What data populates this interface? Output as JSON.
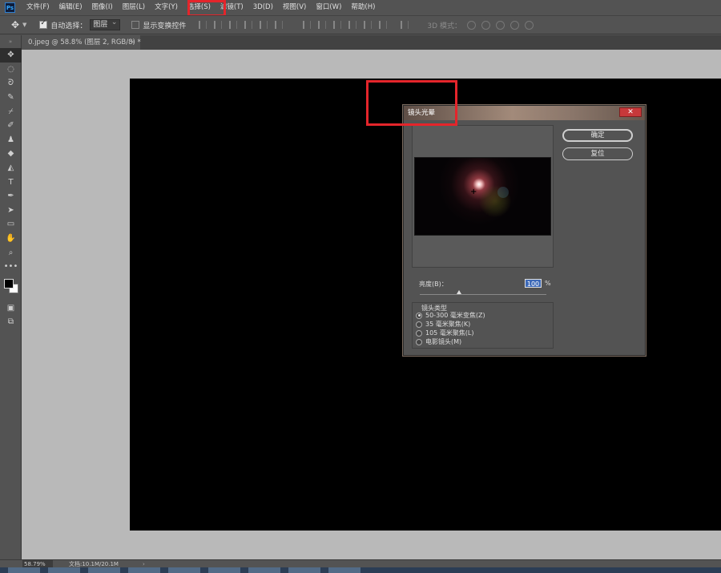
{
  "app": {
    "logo": "Ps"
  },
  "menu": [
    "文件(F)",
    "编辑(E)",
    "图像(I)",
    "图层(L)",
    "文字(Y)",
    "选择(S)",
    "滤镜(T)",
    "3D(D)",
    "视图(V)",
    "窗口(W)",
    "帮助(H)"
  ],
  "options": {
    "auto_select_label": "自动选择：",
    "auto_select_value": "图层",
    "show_transform_label": "显示变换控件",
    "mode_3d_label": "3D 模式："
  },
  "document": {
    "tab_title": "0.jpeg @ 58.8% (图层 2, RGB/8) *",
    "tab_close": "×"
  },
  "status": {
    "zoom": "58.79%",
    "doc_info": "文档:10.1M/20.1M",
    "arrow": "›"
  },
  "dialog": {
    "title": "镜头光晕",
    "close": "✕",
    "ok_label": "确定",
    "reset_label": "复位",
    "brightness_label": "亮度(B)：",
    "brightness_value": "100",
    "brightness_unit": "%",
    "brightness_percent": 100,
    "lens_type_title": "镜头类型",
    "lens_options": [
      "50-300 毫米变焦(Z)",
      "35 毫米聚焦(K)",
      "105 毫米聚焦(L)",
      "电影镜头(M)"
    ],
    "selected_lens_index": 0
  },
  "colors": {
    "highlight": "#e4252b",
    "foreground": "#000000",
    "background": "#ffffff"
  }
}
